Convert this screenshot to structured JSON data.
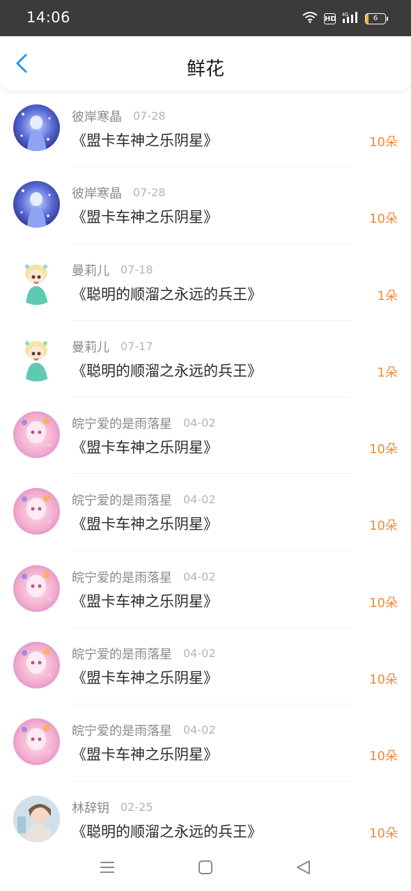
{
  "status_bar": {
    "time": "14:06",
    "battery": "6",
    "network": "4G"
  },
  "header": {
    "title": "鲜花"
  },
  "items": [
    {
      "name": "彼岸寒晶",
      "date": "07-28",
      "title": "《盟卡车神之乐阴星》",
      "count": "10朵",
      "avatar": "a"
    },
    {
      "name": "彼岸寒晶",
      "date": "07-28",
      "title": "《盟卡车神之乐阴星》",
      "count": "10朵",
      "avatar": "a"
    },
    {
      "name": "曼莉儿",
      "date": "07-18",
      "title": "《聪明的顺溜之永远的兵王》",
      "count": "1朵",
      "avatar": "b"
    },
    {
      "name": "曼莉儿",
      "date": "07-17",
      "title": "《聪明的顺溜之永远的兵王》",
      "count": "1朵",
      "avatar": "b"
    },
    {
      "name": "皖宁爱的是雨落星",
      "date": "04-02",
      "title": "《盟卡车神之乐阴星》",
      "count": "10朵",
      "avatar": "c"
    },
    {
      "name": "皖宁爱的是雨落星",
      "date": "04-02",
      "title": "《盟卡车神之乐阴星》",
      "count": "10朵",
      "avatar": "c"
    },
    {
      "name": "皖宁爱的是雨落星",
      "date": "04-02",
      "title": "《盟卡车神之乐阴星》",
      "count": "10朵",
      "avatar": "c"
    },
    {
      "name": "皖宁爱的是雨落星",
      "date": "04-02",
      "title": "《盟卡车神之乐阴星》",
      "count": "10朵",
      "avatar": "c"
    },
    {
      "name": "皖宁爱的是雨落星",
      "date": "04-02",
      "title": "《盟卡车神之乐阴星》",
      "count": "10朵",
      "avatar": "c"
    },
    {
      "name": "林辞钥",
      "date": "02-25",
      "title": "《聪明的顺溜之永远的兵王》",
      "count": "10朵",
      "avatar": "d"
    }
  ],
  "colors": {
    "accent": "#2196f3",
    "count": "#ee8a38",
    "status_bar": "#3b3b3b"
  },
  "icons": {
    "back": "chevron-left-icon",
    "menu": "menu-icon",
    "home": "home-square-icon",
    "nav_back": "triangle-back-icon"
  }
}
